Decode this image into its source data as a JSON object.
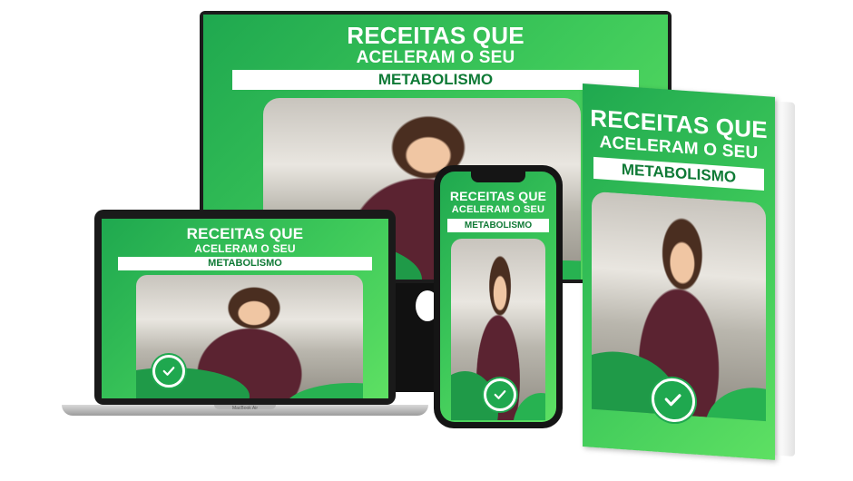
{
  "colors": {
    "accent": "#1fa84f",
    "accent_light": "#5ee063",
    "band_text": "#0f7a36"
  },
  "title_line1": "RECEITAS QUE",
  "title_line2": "ACELERAM O SEU",
  "title_band": "METABOLISMO",
  "laptop_brand": "MacBook Air",
  "icons": {
    "badge": "check-badge-icon"
  }
}
